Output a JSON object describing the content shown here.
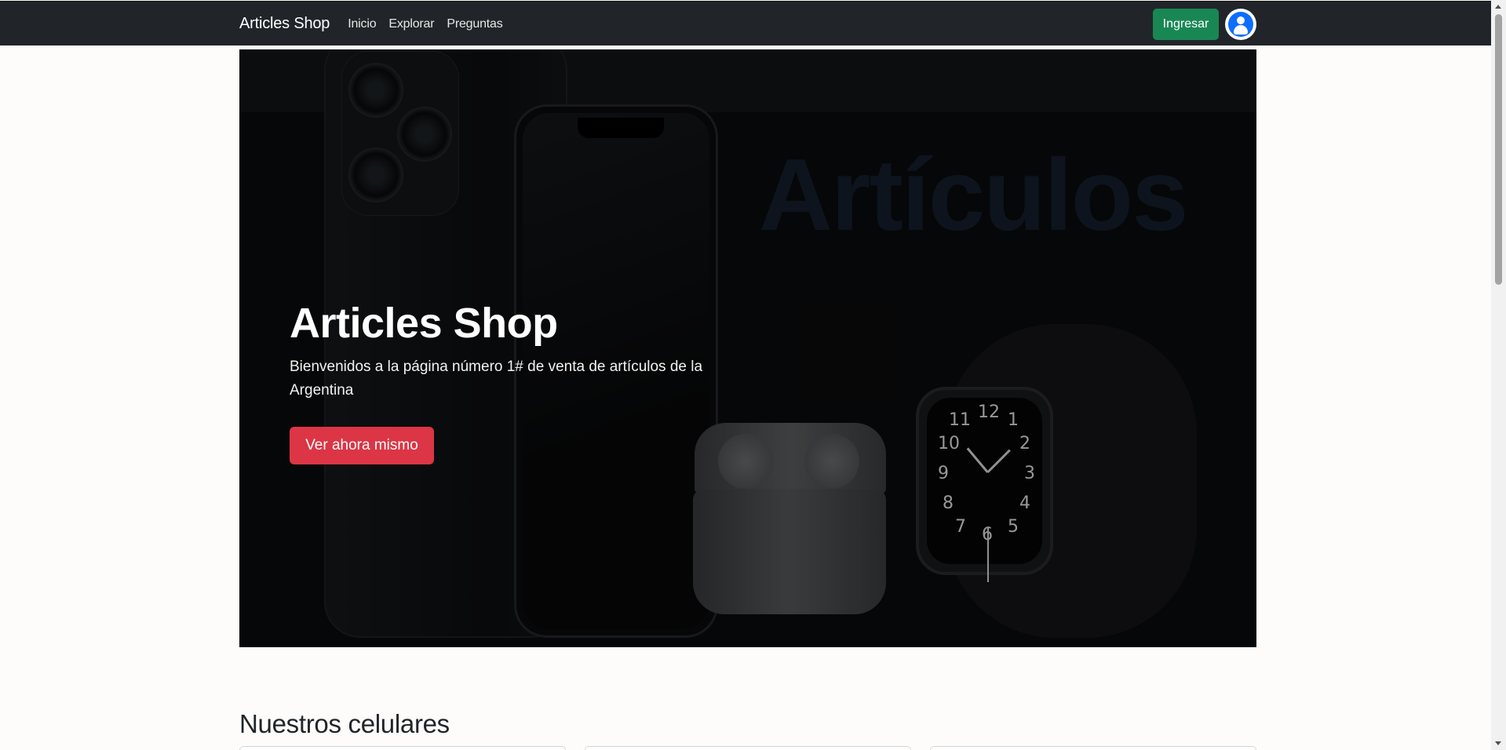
{
  "navbar": {
    "brand": "Articles Shop",
    "links": [
      "Inicio",
      "Explorar",
      "Preguntas"
    ],
    "login_label": "Ingresar"
  },
  "hero": {
    "watermark": "Artículos",
    "title": "Articles Shop",
    "subtitle": "Bienvenidos a la página número 1# de venta de artículos de la Argentina",
    "cta_label": "Ver ahora mismo"
  },
  "watch": {
    "hours": [
      "12",
      "1",
      "2",
      "3",
      "4",
      "5",
      "6",
      "7",
      "8",
      "9",
      "10",
      "11"
    ]
  },
  "section": {
    "title": "Nuestros celulares"
  },
  "colors": {
    "navbar": "#212529",
    "login_button": "#198754",
    "cta_button": "#dc3545",
    "avatar": "#0d6efd"
  }
}
